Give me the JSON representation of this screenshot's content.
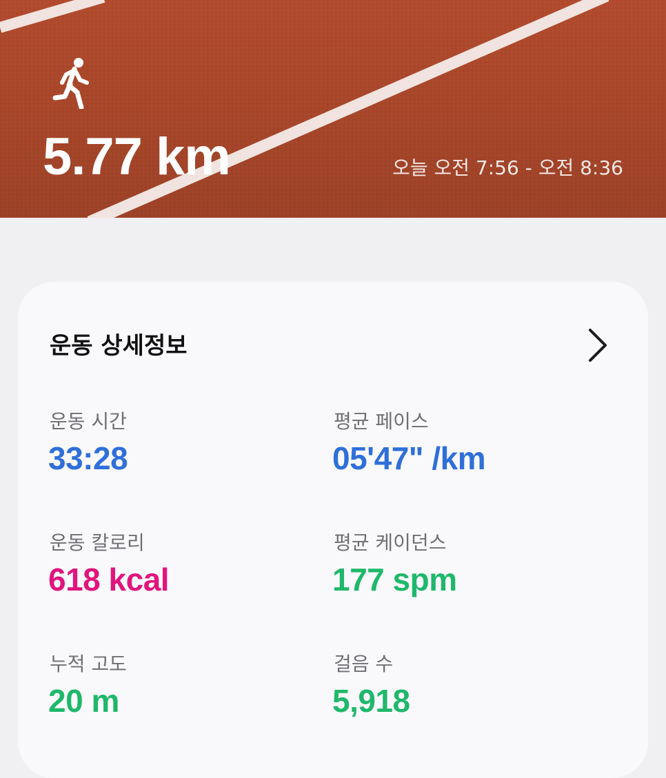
{
  "header": {
    "activity_icon": "running-person-icon",
    "distance": "5.77 km",
    "time_range": "오늘 오전 7:56 - 오전 8:36"
  },
  "details": {
    "title": "운동 상세정보",
    "more_icon": "chevron-right-icon",
    "stats": [
      {
        "label": "운동 시간",
        "value": "33:28",
        "color": "#2f6fd9"
      },
      {
        "label": "평균 페이스",
        "value": "05'47\" /km",
        "color": "#2f6fd9"
      },
      {
        "label": "운동 칼로리",
        "value": "618 kcal",
        "color": "#e0157d"
      },
      {
        "label": "평균 케이던스",
        "value": "177 spm",
        "color": "#1fb86a"
      },
      {
        "label": "누적 고도",
        "value": "20 m",
        "color": "#1fb86a"
      },
      {
        "label": "걸음 수",
        "value": "5,918",
        "color": "#1fb86a"
      }
    ]
  }
}
